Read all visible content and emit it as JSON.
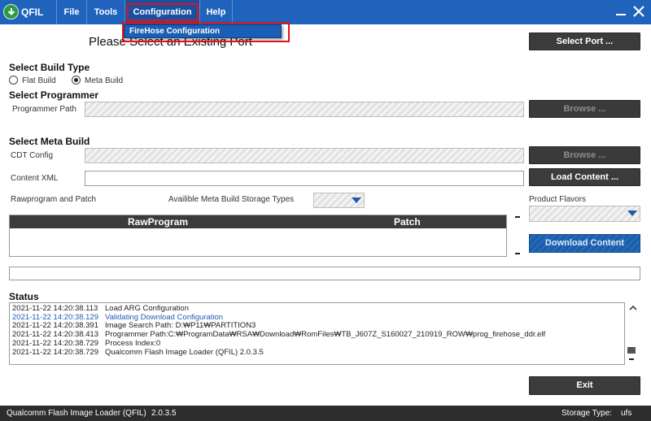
{
  "app": {
    "name": "QFIL"
  },
  "menu": {
    "file": "File",
    "tools": "Tools",
    "configuration": "Configuration",
    "help": "Help"
  },
  "dropdown": {
    "firehose_configuration": "FireHose Configuration"
  },
  "heading": "Please Select an Existing Port",
  "select_port_button": "Select Port ...",
  "build_type": {
    "title": "Select Build Type",
    "options": [
      "Flat Build",
      "Meta Build"
    ],
    "selected": "Meta Build"
  },
  "programmer": {
    "title": "Select Programmer",
    "path_label": "Programmer Path",
    "browse": "Browse ..."
  },
  "meta_build": {
    "title": "Select Meta Build",
    "cdt_label": "CDT Config",
    "browse": "Browse ...",
    "content_xml_label": "Content XML",
    "load_content": "Load Content ...",
    "rawprogram_label": "Rawprogram and Patch",
    "storage_types_label": "Availible Meta Build Storage Types",
    "product_flavors_label": "Product Flavors",
    "grid_columns": [
      "RawProgram",
      "Patch"
    ],
    "download_content": "Download Content"
  },
  "status": {
    "title": "Status",
    "lines": [
      {
        "time": "2021-11-22 14:20:38.113",
        "msg": "Load ARG Configuration"
      },
      {
        "time": "2021-11-22 14:20:38.129",
        "msg": "Validating Download Configuration"
      },
      {
        "time": "2021-11-22 14:20:38.391",
        "msg": "Image Search Path: D:₩P11₩PARTITION3"
      },
      {
        "time": "2021-11-22 14:20:38.413",
        "msg": "Programmer Path:C:₩ProgramData₩RSA₩Download₩RomFiles₩TB_J607Z_S160027_210919_ROW₩prog_firehose_ddr.elf"
      },
      {
        "time": "2021-11-22 14:20:38.729",
        "msg": "Process Index:0"
      },
      {
        "time": "2021-11-22 14:20:38.729",
        "msg": "Qualcomm Flash Image Loader (QFIL) 2.0.3.5"
      }
    ]
  },
  "exit_button": "Exit",
  "footer": {
    "app_name": "Qualcomm Flash Image Loader (QFIL)",
    "version": "2.0.3.5",
    "storage_type_label": "Storage Type:",
    "storage_type_value": "ufs"
  },
  "colors": {
    "titlebar": "#1f63bd",
    "highlight_box": "#e0121b",
    "dark_button": "#3c3c3c",
    "accent_blue": "#1c5da9"
  }
}
